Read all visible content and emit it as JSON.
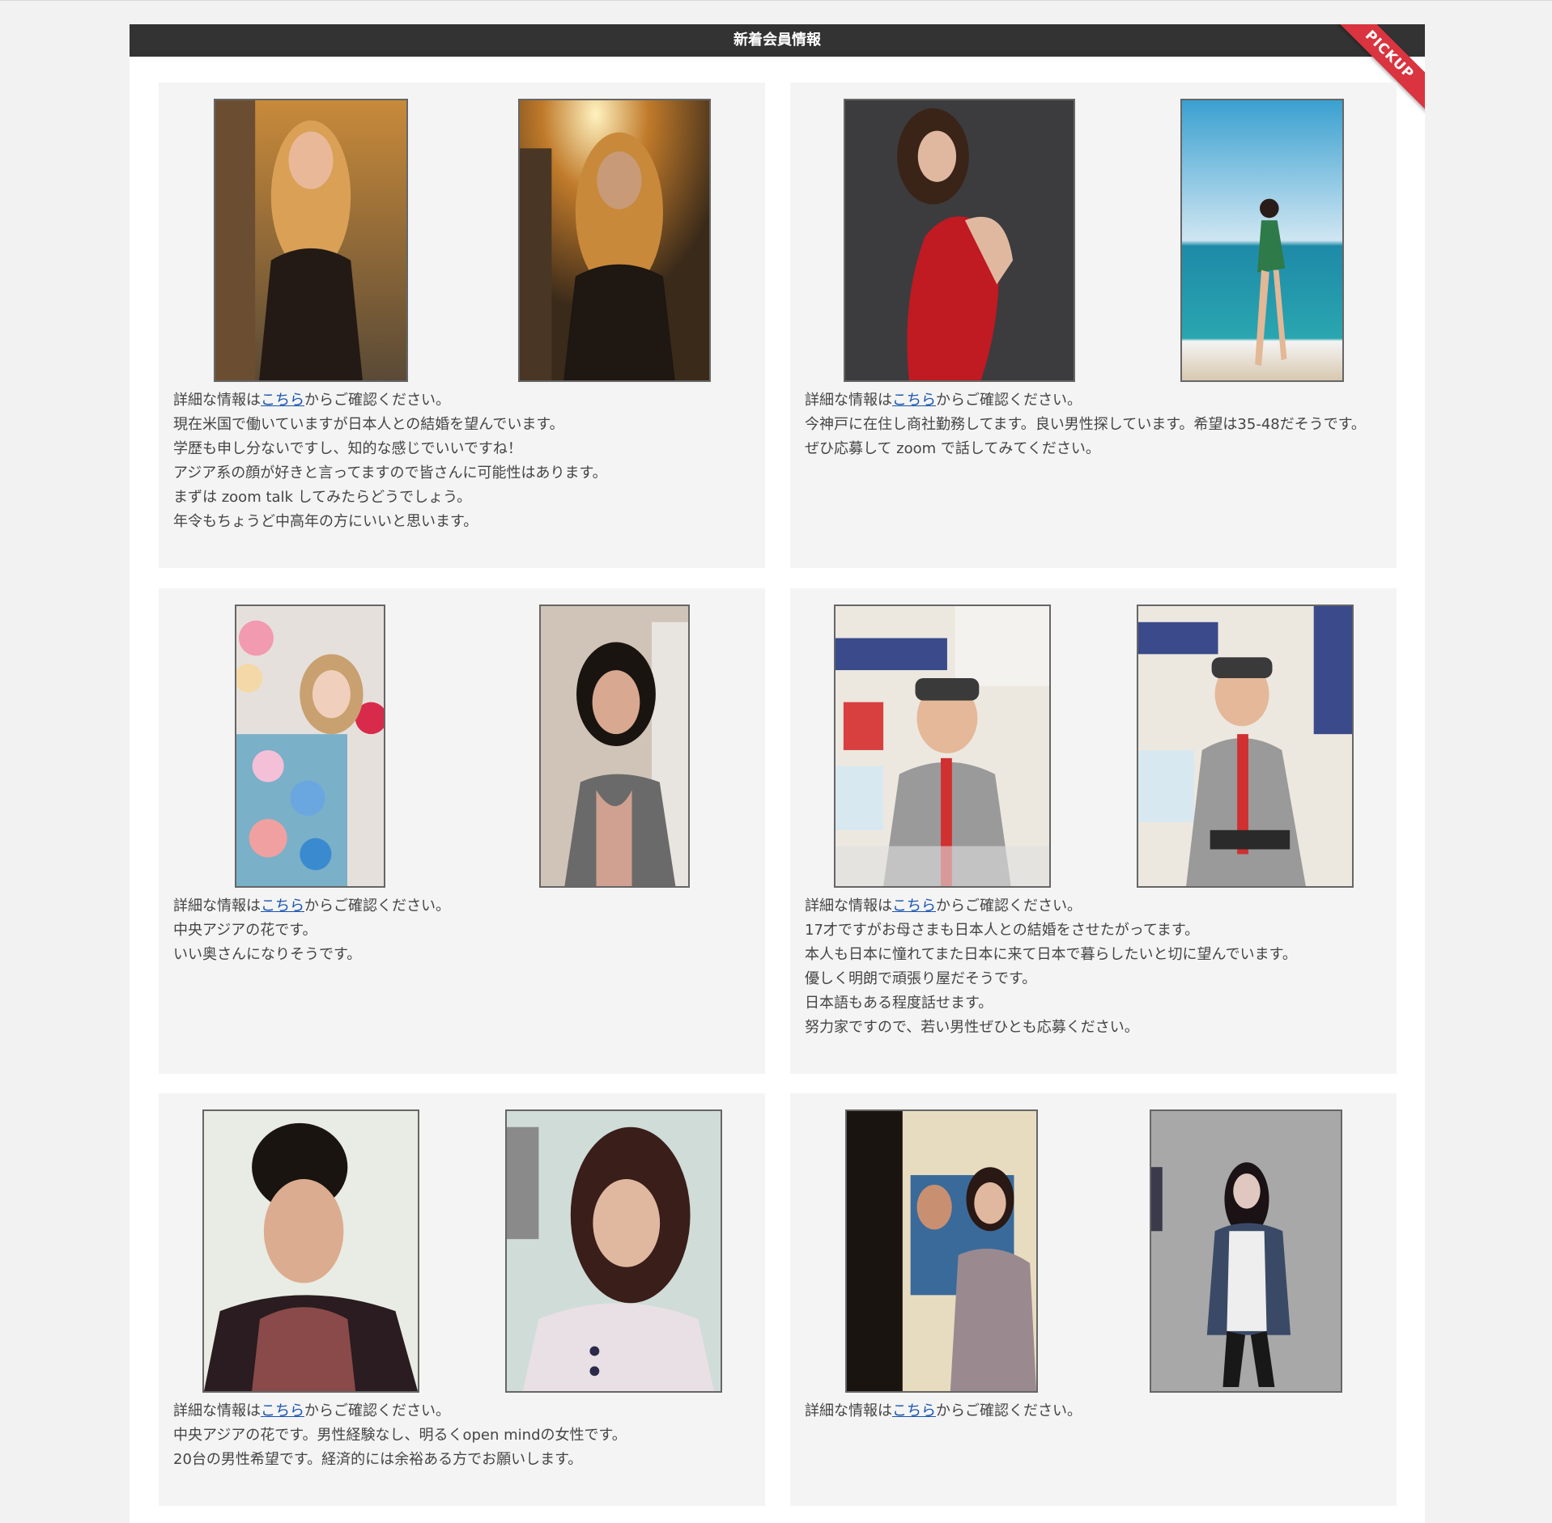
{
  "header": {
    "title": "新着会員情報",
    "ribbon": "PICKUP"
  },
  "colors": {
    "header_bg": "#333333",
    "ribbon": "#d9343f",
    "card_bg": "#f4f4f4",
    "link": "#1a55b0"
  },
  "cards": [
    {
      "link_prefix": "詳細な情報は",
      "link_text": "こちら",
      "link_suffix": "からご確認ください。",
      "lines": [
        "現在米国で働いていますが日本人との結婚を望んでいます。",
        "学歴も申し分ないですし、知的な感じでいいですね！",
        "アジア系の顔が好きと言ってますので皆さんに可能性はあります。",
        "まずは zoom talk してみたらどうでしょう。",
        "年令もちょうど中高年の方にいいと思います。"
      ]
    },
    {
      "link_prefix": "詳細な情報は",
      "link_text": "こちら",
      "link_suffix": "からご確認ください。",
      "lines": [
        "今神戸に在住し商社勤務してます。良い男性探しています。希望は35-48だそうです。",
        "ぜひ応募して zoom で話してみてください。"
      ]
    },
    {
      "link_prefix": "詳細な情報は",
      "link_text": "こちら",
      "link_suffix": "からご確認ください。",
      "lines": [
        "中央アジアの花です。",
        "いい奥さんになりそうです。"
      ]
    },
    {
      "link_prefix": "詳細な情報は",
      "link_text": "こちら",
      "link_suffix": "からご確認ください。",
      "lines": [
        "17才ですがお母さまも日本人との結婚をさせたがってます。",
        "本人も日本に憧れてまた日本に来て日本で暮らしたいと切に望んでいます。",
        "優しく明朗で頑張り屋だそうです。",
        "日本語もある程度話せます。",
        "努力家ですので、若い男性ぜひとも応募ください。"
      ]
    },
    {
      "link_prefix": "詳細な情報は",
      "link_text": "こちら",
      "link_suffix": "からご確認ください。",
      "lines": [
        "中央アジアの花です。男性経験なし、明るくopen mindの女性です。",
        "20台の男性希望です。経済的には余裕ある方でお願いします。"
      ]
    },
    {
      "link_prefix": "詳細な情報は",
      "link_text": "こちら",
      "link_suffix": "からご確認ください。",
      "lines": []
    }
  ]
}
